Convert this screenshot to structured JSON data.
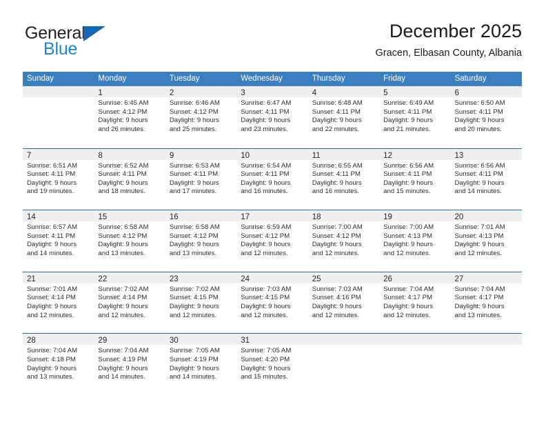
{
  "brand": {
    "name_part1": "General",
    "name_part2": "Blue",
    "accent_color": "#1668b3",
    "accent_color_light": "#1b86d4"
  },
  "header": {
    "title": "December 2025",
    "location": "Gracen, Elbasan County, Albania"
  },
  "colors": {
    "header_band": "#3c7fc1",
    "week_divider": "#2a6ba8",
    "daynum_band": "#efefef"
  },
  "weekdays": [
    "Sunday",
    "Monday",
    "Tuesday",
    "Wednesday",
    "Thursday",
    "Friday",
    "Saturday"
  ],
  "weeks": [
    [
      {
        "day": "",
        "sunrise": "",
        "sunset": "",
        "daylight1": "",
        "daylight2": ""
      },
      {
        "day": "1",
        "sunrise": "Sunrise: 6:45 AM",
        "sunset": "Sunset: 4:12 PM",
        "daylight1": "Daylight: 9 hours",
        "daylight2": "and 26 minutes."
      },
      {
        "day": "2",
        "sunrise": "Sunrise: 6:46 AM",
        "sunset": "Sunset: 4:12 PM",
        "daylight1": "Daylight: 9 hours",
        "daylight2": "and 25 minutes."
      },
      {
        "day": "3",
        "sunrise": "Sunrise: 6:47 AM",
        "sunset": "Sunset: 4:11 PM",
        "daylight1": "Daylight: 9 hours",
        "daylight2": "and 23 minutes."
      },
      {
        "day": "4",
        "sunrise": "Sunrise: 6:48 AM",
        "sunset": "Sunset: 4:11 PM",
        "daylight1": "Daylight: 9 hours",
        "daylight2": "and 22 minutes."
      },
      {
        "day": "5",
        "sunrise": "Sunrise: 6:49 AM",
        "sunset": "Sunset: 4:11 PM",
        "daylight1": "Daylight: 9 hours",
        "daylight2": "and 21 minutes."
      },
      {
        "day": "6",
        "sunrise": "Sunrise: 6:50 AM",
        "sunset": "Sunset: 4:11 PM",
        "daylight1": "Daylight: 9 hours",
        "daylight2": "and 20 minutes."
      }
    ],
    [
      {
        "day": "7",
        "sunrise": "Sunrise: 6:51 AM",
        "sunset": "Sunset: 4:11 PM",
        "daylight1": "Daylight: 9 hours",
        "daylight2": "and 19 minutes."
      },
      {
        "day": "8",
        "sunrise": "Sunrise: 6:52 AM",
        "sunset": "Sunset: 4:11 PM",
        "daylight1": "Daylight: 9 hours",
        "daylight2": "and 18 minutes."
      },
      {
        "day": "9",
        "sunrise": "Sunrise: 6:53 AM",
        "sunset": "Sunset: 4:11 PM",
        "daylight1": "Daylight: 9 hours",
        "daylight2": "and 17 minutes."
      },
      {
        "day": "10",
        "sunrise": "Sunrise: 6:54 AM",
        "sunset": "Sunset: 4:11 PM",
        "daylight1": "Daylight: 9 hours",
        "daylight2": "and 16 minutes."
      },
      {
        "day": "11",
        "sunrise": "Sunrise: 6:55 AM",
        "sunset": "Sunset: 4:11 PM",
        "daylight1": "Daylight: 9 hours",
        "daylight2": "and 16 minutes."
      },
      {
        "day": "12",
        "sunrise": "Sunrise: 6:56 AM",
        "sunset": "Sunset: 4:11 PM",
        "daylight1": "Daylight: 9 hours",
        "daylight2": "and 15 minutes."
      },
      {
        "day": "13",
        "sunrise": "Sunrise: 6:56 AM",
        "sunset": "Sunset: 4:11 PM",
        "daylight1": "Daylight: 9 hours",
        "daylight2": "and 14 minutes."
      }
    ],
    [
      {
        "day": "14",
        "sunrise": "Sunrise: 6:57 AM",
        "sunset": "Sunset: 4:11 PM",
        "daylight1": "Daylight: 9 hours",
        "daylight2": "and 14 minutes."
      },
      {
        "day": "15",
        "sunrise": "Sunrise: 6:58 AM",
        "sunset": "Sunset: 4:12 PM",
        "daylight1": "Daylight: 9 hours",
        "daylight2": "and 13 minutes."
      },
      {
        "day": "16",
        "sunrise": "Sunrise: 6:58 AM",
        "sunset": "Sunset: 4:12 PM",
        "daylight1": "Daylight: 9 hours",
        "daylight2": "and 13 minutes."
      },
      {
        "day": "17",
        "sunrise": "Sunrise: 6:59 AM",
        "sunset": "Sunset: 4:12 PM",
        "daylight1": "Daylight: 9 hours",
        "daylight2": "and 12 minutes."
      },
      {
        "day": "18",
        "sunrise": "Sunrise: 7:00 AM",
        "sunset": "Sunset: 4:12 PM",
        "daylight1": "Daylight: 9 hours",
        "daylight2": "and 12 minutes."
      },
      {
        "day": "19",
        "sunrise": "Sunrise: 7:00 AM",
        "sunset": "Sunset: 4:13 PM",
        "daylight1": "Daylight: 9 hours",
        "daylight2": "and 12 minutes."
      },
      {
        "day": "20",
        "sunrise": "Sunrise: 7:01 AM",
        "sunset": "Sunset: 4:13 PM",
        "daylight1": "Daylight: 9 hours",
        "daylight2": "and 12 minutes."
      }
    ],
    [
      {
        "day": "21",
        "sunrise": "Sunrise: 7:01 AM",
        "sunset": "Sunset: 4:14 PM",
        "daylight1": "Daylight: 9 hours",
        "daylight2": "and 12 minutes."
      },
      {
        "day": "22",
        "sunrise": "Sunrise: 7:02 AM",
        "sunset": "Sunset: 4:14 PM",
        "daylight1": "Daylight: 9 hours",
        "daylight2": "and 12 minutes."
      },
      {
        "day": "23",
        "sunrise": "Sunrise: 7:02 AM",
        "sunset": "Sunset: 4:15 PM",
        "daylight1": "Daylight: 9 hours",
        "daylight2": "and 12 minutes."
      },
      {
        "day": "24",
        "sunrise": "Sunrise: 7:03 AM",
        "sunset": "Sunset: 4:15 PM",
        "daylight1": "Daylight: 9 hours",
        "daylight2": "and 12 minutes."
      },
      {
        "day": "25",
        "sunrise": "Sunrise: 7:03 AM",
        "sunset": "Sunset: 4:16 PM",
        "daylight1": "Daylight: 9 hours",
        "daylight2": "and 12 minutes."
      },
      {
        "day": "26",
        "sunrise": "Sunrise: 7:04 AM",
        "sunset": "Sunset: 4:17 PM",
        "daylight1": "Daylight: 9 hours",
        "daylight2": "and 12 minutes."
      },
      {
        "day": "27",
        "sunrise": "Sunrise: 7:04 AM",
        "sunset": "Sunset: 4:17 PM",
        "daylight1": "Daylight: 9 hours",
        "daylight2": "and 13 minutes."
      }
    ],
    [
      {
        "day": "28",
        "sunrise": "Sunrise: 7:04 AM",
        "sunset": "Sunset: 4:18 PM",
        "daylight1": "Daylight: 9 hours",
        "daylight2": "and 13 minutes."
      },
      {
        "day": "29",
        "sunrise": "Sunrise: 7:04 AM",
        "sunset": "Sunset: 4:19 PM",
        "daylight1": "Daylight: 9 hours",
        "daylight2": "and 14 minutes."
      },
      {
        "day": "30",
        "sunrise": "Sunrise: 7:05 AM",
        "sunset": "Sunset: 4:19 PM",
        "daylight1": "Daylight: 9 hours",
        "daylight2": "and 14 minutes."
      },
      {
        "day": "31",
        "sunrise": "Sunrise: 7:05 AM",
        "sunset": "Sunset: 4:20 PM",
        "daylight1": "Daylight: 9 hours",
        "daylight2": "and 15 minutes."
      },
      {
        "day": "",
        "sunrise": "",
        "sunset": "",
        "daylight1": "",
        "daylight2": ""
      },
      {
        "day": "",
        "sunrise": "",
        "sunset": "",
        "daylight1": "",
        "daylight2": ""
      },
      {
        "day": "",
        "sunrise": "",
        "sunset": "",
        "daylight1": "",
        "daylight2": ""
      }
    ]
  ]
}
